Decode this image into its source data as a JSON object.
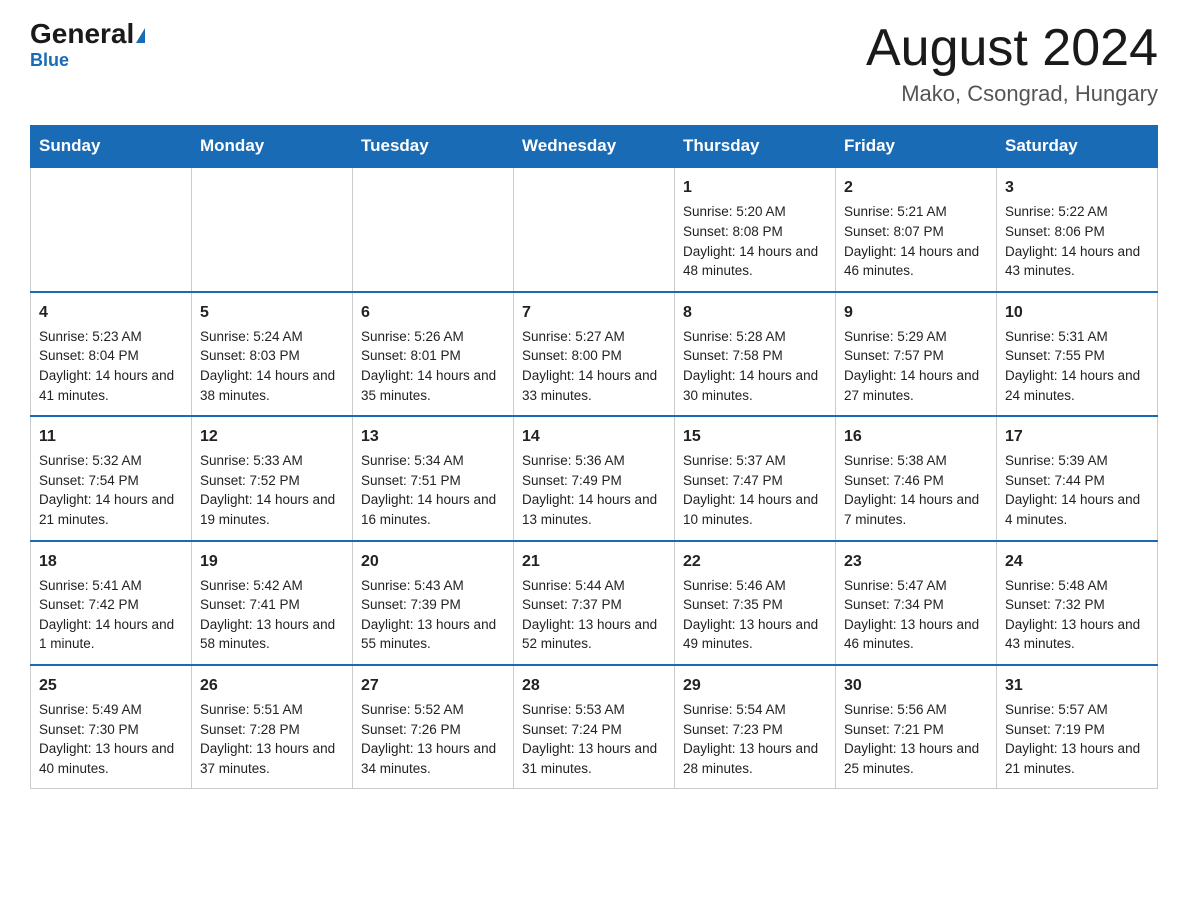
{
  "header": {
    "logo_general": "General",
    "logo_blue": "Blue",
    "month_title": "August 2024",
    "location": "Mako, Csongrad, Hungary"
  },
  "days_of_week": [
    "Sunday",
    "Monday",
    "Tuesday",
    "Wednesday",
    "Thursday",
    "Friday",
    "Saturday"
  ],
  "weeks": [
    {
      "days": [
        {
          "num": "",
          "info": ""
        },
        {
          "num": "",
          "info": ""
        },
        {
          "num": "",
          "info": ""
        },
        {
          "num": "",
          "info": ""
        },
        {
          "num": "1",
          "info": "Sunrise: 5:20 AM\nSunset: 8:08 PM\nDaylight: 14 hours and 48 minutes."
        },
        {
          "num": "2",
          "info": "Sunrise: 5:21 AM\nSunset: 8:07 PM\nDaylight: 14 hours and 46 minutes."
        },
        {
          "num": "3",
          "info": "Sunrise: 5:22 AM\nSunset: 8:06 PM\nDaylight: 14 hours and 43 minutes."
        }
      ]
    },
    {
      "days": [
        {
          "num": "4",
          "info": "Sunrise: 5:23 AM\nSunset: 8:04 PM\nDaylight: 14 hours and 41 minutes."
        },
        {
          "num": "5",
          "info": "Sunrise: 5:24 AM\nSunset: 8:03 PM\nDaylight: 14 hours and 38 minutes."
        },
        {
          "num": "6",
          "info": "Sunrise: 5:26 AM\nSunset: 8:01 PM\nDaylight: 14 hours and 35 minutes."
        },
        {
          "num": "7",
          "info": "Sunrise: 5:27 AM\nSunset: 8:00 PM\nDaylight: 14 hours and 33 minutes."
        },
        {
          "num": "8",
          "info": "Sunrise: 5:28 AM\nSunset: 7:58 PM\nDaylight: 14 hours and 30 minutes."
        },
        {
          "num": "9",
          "info": "Sunrise: 5:29 AM\nSunset: 7:57 PM\nDaylight: 14 hours and 27 minutes."
        },
        {
          "num": "10",
          "info": "Sunrise: 5:31 AM\nSunset: 7:55 PM\nDaylight: 14 hours and 24 minutes."
        }
      ]
    },
    {
      "days": [
        {
          "num": "11",
          "info": "Sunrise: 5:32 AM\nSunset: 7:54 PM\nDaylight: 14 hours and 21 minutes."
        },
        {
          "num": "12",
          "info": "Sunrise: 5:33 AM\nSunset: 7:52 PM\nDaylight: 14 hours and 19 minutes."
        },
        {
          "num": "13",
          "info": "Sunrise: 5:34 AM\nSunset: 7:51 PM\nDaylight: 14 hours and 16 minutes."
        },
        {
          "num": "14",
          "info": "Sunrise: 5:36 AM\nSunset: 7:49 PM\nDaylight: 14 hours and 13 minutes."
        },
        {
          "num": "15",
          "info": "Sunrise: 5:37 AM\nSunset: 7:47 PM\nDaylight: 14 hours and 10 minutes."
        },
        {
          "num": "16",
          "info": "Sunrise: 5:38 AM\nSunset: 7:46 PM\nDaylight: 14 hours and 7 minutes."
        },
        {
          "num": "17",
          "info": "Sunrise: 5:39 AM\nSunset: 7:44 PM\nDaylight: 14 hours and 4 minutes."
        }
      ]
    },
    {
      "days": [
        {
          "num": "18",
          "info": "Sunrise: 5:41 AM\nSunset: 7:42 PM\nDaylight: 14 hours and 1 minute."
        },
        {
          "num": "19",
          "info": "Sunrise: 5:42 AM\nSunset: 7:41 PM\nDaylight: 13 hours and 58 minutes."
        },
        {
          "num": "20",
          "info": "Sunrise: 5:43 AM\nSunset: 7:39 PM\nDaylight: 13 hours and 55 minutes."
        },
        {
          "num": "21",
          "info": "Sunrise: 5:44 AM\nSunset: 7:37 PM\nDaylight: 13 hours and 52 minutes."
        },
        {
          "num": "22",
          "info": "Sunrise: 5:46 AM\nSunset: 7:35 PM\nDaylight: 13 hours and 49 minutes."
        },
        {
          "num": "23",
          "info": "Sunrise: 5:47 AM\nSunset: 7:34 PM\nDaylight: 13 hours and 46 minutes."
        },
        {
          "num": "24",
          "info": "Sunrise: 5:48 AM\nSunset: 7:32 PM\nDaylight: 13 hours and 43 minutes."
        }
      ]
    },
    {
      "days": [
        {
          "num": "25",
          "info": "Sunrise: 5:49 AM\nSunset: 7:30 PM\nDaylight: 13 hours and 40 minutes."
        },
        {
          "num": "26",
          "info": "Sunrise: 5:51 AM\nSunset: 7:28 PM\nDaylight: 13 hours and 37 minutes."
        },
        {
          "num": "27",
          "info": "Sunrise: 5:52 AM\nSunset: 7:26 PM\nDaylight: 13 hours and 34 minutes."
        },
        {
          "num": "28",
          "info": "Sunrise: 5:53 AM\nSunset: 7:24 PM\nDaylight: 13 hours and 31 minutes."
        },
        {
          "num": "29",
          "info": "Sunrise: 5:54 AM\nSunset: 7:23 PM\nDaylight: 13 hours and 28 minutes."
        },
        {
          "num": "30",
          "info": "Sunrise: 5:56 AM\nSunset: 7:21 PM\nDaylight: 13 hours and 25 minutes."
        },
        {
          "num": "31",
          "info": "Sunrise: 5:57 AM\nSunset: 7:19 PM\nDaylight: 13 hours and 21 minutes."
        }
      ]
    }
  ]
}
